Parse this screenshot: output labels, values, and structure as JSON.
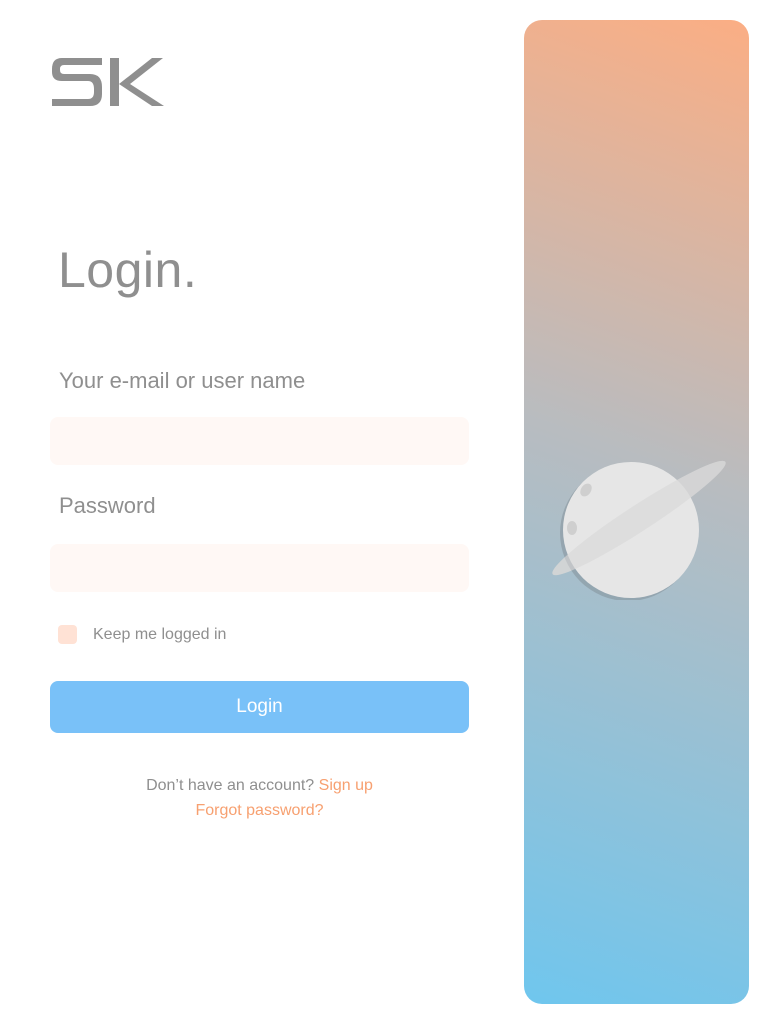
{
  "brand": {
    "logo_text": "SK"
  },
  "form": {
    "title": "Login.",
    "email_label": "Your e-mail or user name",
    "email_value": "",
    "password_label": "Password",
    "password_value": "",
    "remember_label": "Keep me logged in",
    "remember_checked": false,
    "submit_label": "Login"
  },
  "footer": {
    "no_account_text": "Don’t have an account?",
    "signup_link": "Sign up",
    "forgot_link": "Forgot password?"
  },
  "theme": {
    "text_gray": "#8f8f8f",
    "accent_orange": "#f7a070",
    "button_blue": "#79c1f8",
    "input_bg": "#fff8f5",
    "gradient_top": "#fbae84",
    "gradient_bottom": "#6fc6ee"
  },
  "illustration": {
    "icon": "planet-icon"
  }
}
